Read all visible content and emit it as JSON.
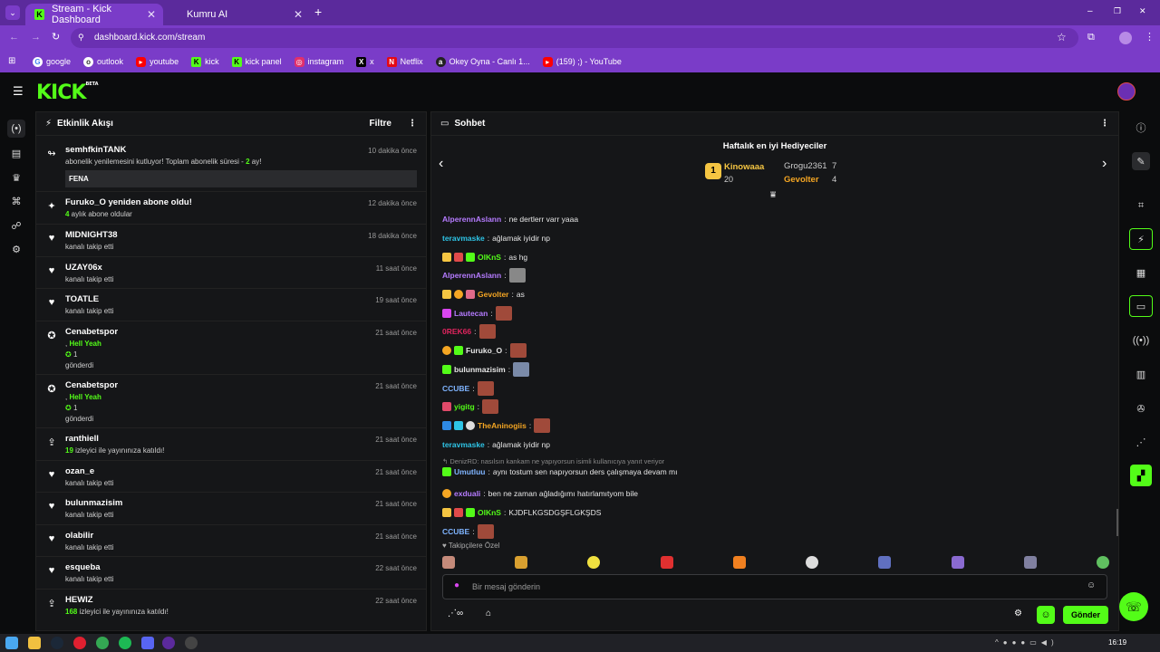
{
  "browser": {
    "tabs": [
      {
        "label": "Stream - Kick Dashboard",
        "active": true
      },
      {
        "label": "Kumru AI",
        "active": false
      }
    ],
    "new_tab": "+",
    "window_controls": [
      "–",
      "❐",
      "✕"
    ],
    "url": "dashboard.kick.com/stream",
    "bookmarks": [
      {
        "label": "google",
        "icon": "google-icon",
        "color": "#ffffff"
      },
      {
        "label": "outlook",
        "icon": "outlook-icon",
        "color": "#ffffff"
      },
      {
        "label": "youtube",
        "icon": "youtube-icon",
        "color": "#ff0000"
      },
      {
        "label": "kick",
        "icon": "kick-icon",
        "color": "#53fc18"
      },
      {
        "label": "kick panel",
        "icon": "kick-icon",
        "color": "#53fc18"
      },
      {
        "label": "instagram",
        "icon": "instagram-icon",
        "color": "#e1306c"
      },
      {
        "label": "x",
        "icon": "x-icon",
        "color": "#000000"
      },
      {
        "label": "Netflix",
        "icon": "netflix-icon",
        "color": "#e50914"
      },
      {
        "label": "Okey Oyna - Canlı 1...",
        "icon": "okey-icon",
        "color": "#222222"
      },
      {
        "label": "(159) ;) - YouTube",
        "icon": "youtube-icon",
        "color": "#ff0000"
      }
    ]
  },
  "kick": {
    "logo": "KICK",
    "logo_badge": "BETA",
    "accent": "#53fc18"
  },
  "activity": {
    "title": "Etkinlik Akışı",
    "filter": "Filtre",
    "items": [
      {
        "icon": "resub-icon",
        "name": "semhfkinTANK",
        "pre": "abonelik yenilemesini kutluyor! Toplam abonelik süresi - ",
        "highlight": "2",
        "post": " ay!",
        "time": "10 dakika önce",
        "quote": "FENA"
      },
      {
        "icon": "sparkle-icon",
        "name": "Furuko_O yeniden abone oldu!",
        "pre": "",
        "highlight": "4",
        "post": " aylık abone oldular",
        "time": "12 dakika önce"
      },
      {
        "icon": "heart-icon",
        "name": "MIDNIGHT38",
        "pre": "kanalı takip etti",
        "highlight": "",
        "post": "",
        "time": "18 dakika önce"
      },
      {
        "icon": "heart-icon",
        "name": "UZAY06x",
        "pre": "kanalı takip etti",
        "highlight": "",
        "post": "",
        "time": "11 saat önce"
      },
      {
        "icon": "heart-icon",
        "name": "TOATLE",
        "pre": "kanalı takip etti",
        "highlight": "",
        "post": "",
        "time": "19 saat önce"
      },
      {
        "icon": "kick-gift-icon",
        "name": "Cenabetspor",
        "line2": "Hell Yeah",
        "count": "1",
        "sent": "gönderdi",
        "time": "21 saat önce"
      },
      {
        "icon": "kick-gift-icon",
        "name": "Cenabetspor",
        "line2": "Hell Yeah",
        "count": "1",
        "sent": "gönderdi",
        "time": "21 saat önce"
      },
      {
        "icon": "raid-icon",
        "name": "ranthiell",
        "pre": "",
        "highlight": "19",
        "post": " izleyici ile yayınınıza katıldı!",
        "time": "21 saat önce"
      },
      {
        "icon": "heart-icon",
        "name": "ozan_e",
        "pre": "kanalı takip etti",
        "highlight": "",
        "post": "",
        "time": "21 saat önce"
      },
      {
        "icon": "heart-icon",
        "name": "bulunmazisim",
        "pre": "kanalı takip etti",
        "highlight": "",
        "post": "",
        "time": "21 saat önce"
      },
      {
        "icon": "heart-icon",
        "name": "olabilir",
        "pre": "kanalı takip etti",
        "highlight": "",
        "post": "",
        "time": "21 saat önce"
      },
      {
        "icon": "heart-icon",
        "name": "esqueba",
        "pre": "kanalı takip etti",
        "highlight": "",
        "post": "",
        "time": "22 saat önce"
      },
      {
        "icon": "raid-icon",
        "name": "HEWIZ",
        "pre": "",
        "highlight": "168",
        "post": " izleyici ile yayınınıza katıldı!",
        "time": "22 saat önce"
      }
    ]
  },
  "chat": {
    "title": "Sohbet",
    "gifters_title": "Haftalık en iyi Hediyeciler",
    "top_gifter": {
      "rank": "1",
      "name": "Kinowaaa",
      "count": "20"
    },
    "gifters": [
      {
        "name": "Grogu2361",
        "count": "7",
        "color": "#cccccc"
      },
      {
        "name": "Gevolter",
        "count": "4",
        "color": "#f5a623"
      }
    ],
    "messages": [
      {
        "user": "AlperennAslann",
        "color": "#b57bff",
        "text": "ne dertlerr varr yaaa",
        "badges": [],
        "emote": false
      },
      {
        "user": "teravmaske",
        "color": "#2ec4e6",
        "text": "ağlamak iyidir np",
        "badges": [],
        "emote": false
      },
      {
        "user": "OlKnS",
        "color": "#53fc18",
        "text": "as hg",
        "badges": [
          "#f5c542",
          "#e04a4a",
          "#53fc18"
        ],
        "emote": false
      },
      {
        "user": "AlperennAslann",
        "color": "#b57bff",
        "text": "",
        "badges": [],
        "emote": true
      },
      {
        "user": "Gevolter",
        "color": "#f5a623",
        "text": "as",
        "badges": [
          "#f5c542",
          "#f5a623",
          "#e06a8a"
        ],
        "emote": false
      },
      {
        "user": "Lautecan",
        "color": "#b57bff",
        "text": "",
        "badges": [
          "#d946ef"
        ],
        "emote": true
      },
      {
        "user": "0REK66",
        "color": "#e0245e",
        "text": "",
        "badges": [],
        "emote": true
      },
      {
        "user": "Furuko_O",
        "color": "#e6e6e6",
        "text": "",
        "badges": [
          "#f5a623",
          "#53fc18"
        ],
        "emote": true
      },
      {
        "user": "bulunmazisim",
        "color": "#e6e6e6",
        "text": "",
        "badges": [
          "#53fc18"
        ],
        "emote": true
      },
      {
        "user": "CCUBE",
        "color": "#7fb4ff",
        "text": "",
        "badges": [],
        "emote": true
      },
      {
        "user": "yigitg",
        "color": "#53fc18",
        "text": "",
        "badges": [
          "#e04a6a"
        ],
        "emote": true
      },
      {
        "user": "TheAninogiis",
        "color": "#f5a623",
        "text": "",
        "badges": [
          "#2e8ae6",
          "#2ec4e6",
          "#dddddd"
        ],
        "emote": true
      },
      {
        "user": "teravmaske",
        "color": "#2ec4e6",
        "text": "ağlamak iyidir np",
        "badges": [],
        "emote": false
      },
      {
        "user": "Umutluu",
        "color": "#7fb4ff",
        "text": "aynı tostum sen napıyorsun ders çalışmaya devam mı",
        "badges": [
          "#53fc18"
        ],
        "emote": false,
        "reply": "DenizRD: nasılsın kankam ne yapıyorsun isimli kullanıcıya yanıt veriyor"
      },
      {
        "user": "exduali",
        "color": "#b57bff",
        "text": "ben ne zaman ağladığımı hatırlamıtyom bile",
        "badges": [
          "#f5a623"
        ],
        "emote": false
      },
      {
        "user": "OlKnS",
        "color": "#53fc18",
        "text": "KJDFLKGSDGŞFLGKŞDS",
        "badges": [
          "#f5c542",
          "#e04a4a",
          "#53fc18"
        ],
        "emote": false
      },
      {
        "user": "CCUBE",
        "color": "#7fb4ff",
        "text": "",
        "badges": [],
        "emote": true
      }
    ],
    "followers_only": "Takipçilere Özel",
    "input_placeholder": "Bir mesaj gönderin",
    "send": "Gönder"
  },
  "taskbar": {
    "time": "16:19"
  }
}
